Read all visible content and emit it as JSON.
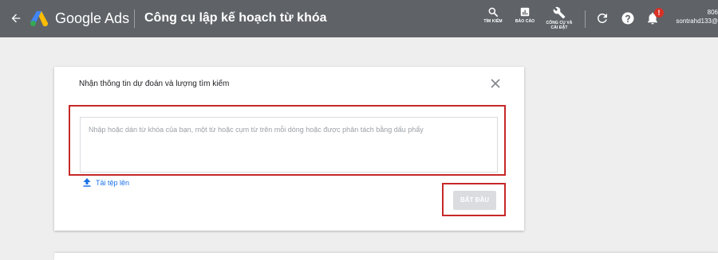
{
  "header": {
    "brand": "Google Ads",
    "page_title": "Công cụ lập kế hoạch từ khóa",
    "tools": {
      "search_label": "TÌM KIẾM",
      "reports_label": "BÁO CÁO",
      "tools_label_line1": "CÔNG CỤ VÀ",
      "tools_label_line2": "CÀI ĐẶT"
    },
    "notification_badge": "!",
    "account": {
      "id_fragment": "806",
      "email_fragment": "sontrahd133@"
    }
  },
  "dialog": {
    "title": "Nhận thông tin dự đoán và lượng tìm kiếm",
    "keyword_placeholder": "Nhập hoặc dán từ khóa của bạn, một từ hoặc cụm từ trên mỗi dòng hoặc được phân tách bằng dấu phẩy",
    "upload_label": "Tải tệp lên",
    "start_label": "BẮT ĐẦU"
  },
  "colors": {
    "topbar": "#5f6368",
    "highlight": "#c62828",
    "link": "#1a73e8",
    "disabled_button": "#dadce0"
  },
  "icons": [
    "back-arrow-icon",
    "google-ads-logo",
    "search-icon",
    "bar-chart-icon",
    "wrench-icon",
    "refresh-icon",
    "help-icon",
    "bell-icon",
    "close-icon",
    "upload-icon"
  ]
}
